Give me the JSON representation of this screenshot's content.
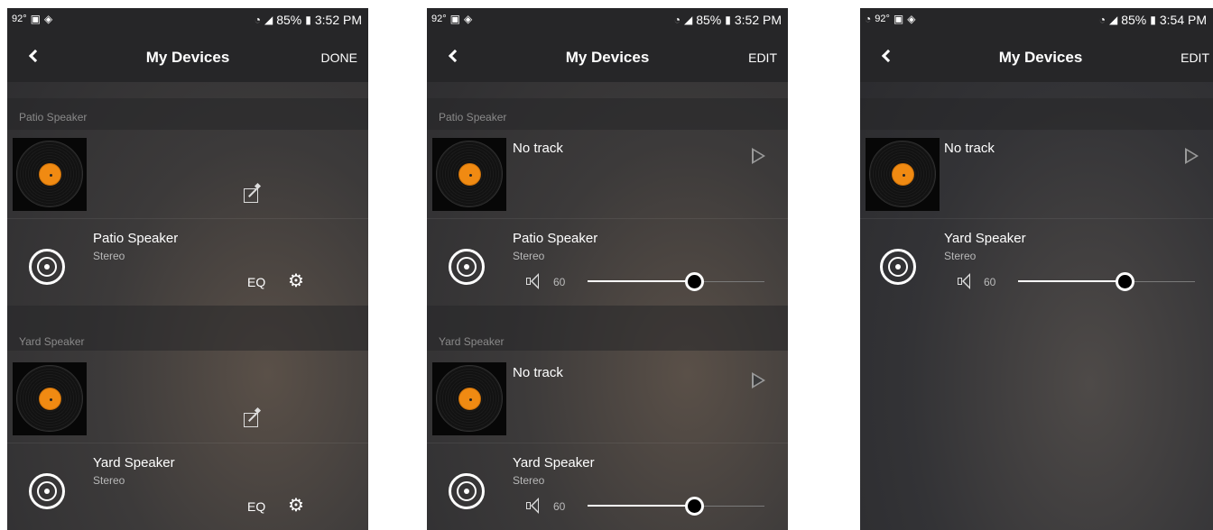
{
  "screens": [
    {
      "status": {
        "left_temp": "92°",
        "battery": "85%",
        "time": "3:52 PM"
      },
      "header": {
        "title": "My Devices",
        "action": "DONE"
      },
      "groups": [
        {
          "label": "Patio Speaker",
          "track": "",
          "speaker": "Patio Speaker",
          "mode": "Stereo",
          "eq": "EQ"
        },
        {
          "label": "Yard Speaker",
          "track": "",
          "speaker": "Yard Speaker",
          "mode": "Stereo",
          "eq": "EQ"
        }
      ]
    },
    {
      "status": {
        "left_temp": "92°",
        "battery": "85%",
        "time": "3:52 PM"
      },
      "header": {
        "title": "My Devices",
        "action": "EDIT"
      },
      "groups": [
        {
          "label": "Patio Speaker",
          "track": "No track",
          "speaker": "Patio Speaker",
          "mode": "Stereo",
          "volume": "60",
          "volume_fraction": 0.6
        },
        {
          "label": "Yard Speaker",
          "track": "No track",
          "speaker": "Yard Speaker",
          "mode": "Stereo",
          "volume": "60",
          "volume_fraction": 0.6
        }
      ]
    },
    {
      "status": {
        "left_temp": "92°",
        "battery": "85%",
        "time": "3:54 PM"
      },
      "header": {
        "title": "My Devices",
        "action": "EDIT"
      },
      "groups": [
        {
          "label": "",
          "track": "No track",
          "speaker": "Yard Speaker",
          "mode": "Stereo",
          "volume": "60",
          "volume_fraction": 0.6
        }
      ]
    }
  ],
  "icons": {
    "back": "chevron-left-icon",
    "edit": "edit-icon",
    "play": "play-icon",
    "settings": "gear-icon",
    "volume": "speaker-volume-icon",
    "speaker": "speaker-icon",
    "album": "vinyl-record-icon"
  },
  "colors": {
    "header": "#262628",
    "record_label": "#f08a12",
    "text": "#ffffff"
  }
}
